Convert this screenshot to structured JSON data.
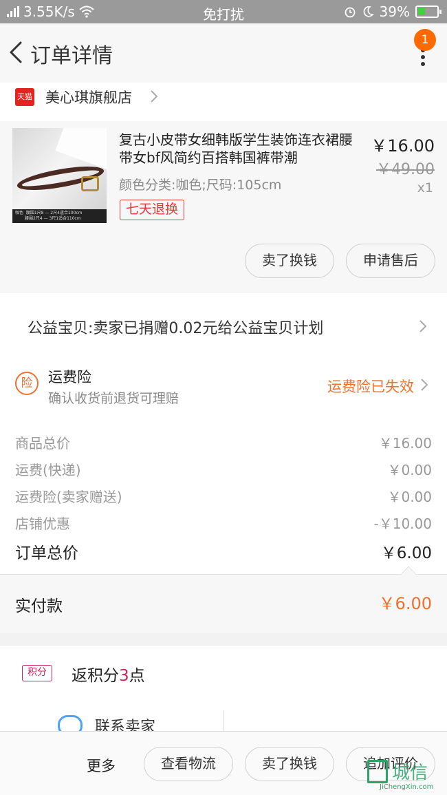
{
  "status_bar": {
    "speed": "3.55K/s",
    "mode": "免打扰",
    "battery": "39%",
    "battery_level": 0.39
  },
  "nav": {
    "title": "订单详情",
    "badge": "1"
  },
  "shop": {
    "platform_tag": "天猫",
    "name": "美心琪旗舰店"
  },
  "product": {
    "title": "复古小皮带女细韩版学生装饰连衣裙腰带女bf风简约百搭韩国裤带潮",
    "spec": "颜色分类:咖色;尺码:105cm",
    "tag": "七天退换",
    "price": "￥16.00",
    "original_price": "￥49.00",
    "quantity": "x1",
    "image_caption_1": "咖色",
    "image_caption_2": "腰围1尺8 — 2尺4适合100cm",
    "image_caption_3": "腰围2尺4 — 3尺1适合110cm",
    "actions": [
      "卖了换钱",
      "申请售后"
    ]
  },
  "charity": {
    "text": "公益宝贝:卖家已捐赠0.02元给公益宝贝计划"
  },
  "insurance": {
    "icon_char": "险",
    "title": "运费险",
    "subtitle": "确认收货前退货可理赔",
    "status": "运费险已失效",
    "status_color": "#f07030"
  },
  "costs": [
    {
      "label": "商品总价",
      "value": "￥16.00"
    },
    {
      "label": "运费(快递)",
      "value": "￥0.00"
    },
    {
      "label": "运费险(卖家赠送)",
      "value": "￥0.00"
    },
    {
      "label": "店铺优惠",
      "value": "-￥10.00"
    }
  ],
  "order_total": {
    "label": "订单总价",
    "value": "￥6.00"
  },
  "paid": {
    "label": "实付款",
    "value": "￥6.00"
  },
  "points": {
    "badge": "积分",
    "text_prefix": "返积分",
    "count": "3",
    "text_suffix": "点"
  },
  "contact": {
    "label": "联系卖家"
  },
  "bottom_bar": {
    "more": "更多",
    "buttons": [
      "查看物流",
      "卖了换钱",
      "追加评价"
    ]
  },
  "watermark": {
    "text": "城信",
    "url": "JiChengXin.com"
  }
}
